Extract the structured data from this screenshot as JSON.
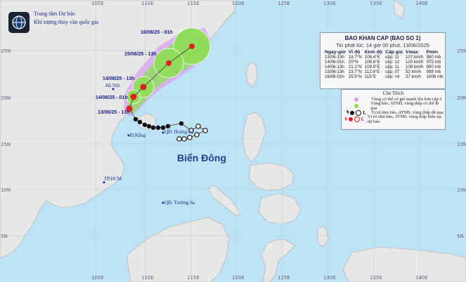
{
  "agency": {
    "line1": "Trung tâm Dự báo",
    "line2": "Khí tượng thủy văn quốc gia"
  },
  "grid": {
    "longitudes": [
      "105E",
      "110E",
      "115E",
      "120E",
      "125E",
      "130E",
      "135E",
      "140E"
    ],
    "latitudes": [
      "25N",
      "20N",
      "15N",
      "10N",
      "5N"
    ]
  },
  "places": {
    "hanoi": "Hà Nội",
    "danang": "Đ.Nẵng",
    "hcm": "TP.HCM",
    "hoangsa": "QĐ. Hoàng Sa",
    "truongsa": "QĐ. Trường Sa"
  },
  "sea_label": "Biển Đông",
  "track_times": [
    "16/06/25 - 01h",
    "15/06/25 - 13h",
    "14/06/25 - 13h",
    "14/06/25 - 01h",
    "13/06/25 - 13h"
  ],
  "bulletin": {
    "title": "BAO KHAN CAP (BAO SO 1)",
    "subtitle": "Tin phát lúc: 14 giờ 00 phút, 13/06/2025",
    "headers": [
      "Ngày-giờ",
      "Vĩ độ",
      "Kinh độ",
      "Cấp gió",
      "Vmax",
      "Pmin"
    ],
    "rows": [
      [
        "13/06-13h",
        "18.7°N",
        "108.4°E",
        "cấp: 11",
        "107 km/h",
        "980 mb"
      ],
      [
        "14/06-01h",
        "20°N",
        "108.8°E",
        "cấp: 12",
        "120 km/h",
        "975 mb"
      ],
      [
        "14/06-13h",
        "21.1°N",
        "109.9°E",
        "cấp: 11",
        "106 km/h",
        "980 mb"
      ],
      [
        "15/06-13h",
        "23.7°N",
        "112.6°E",
        "cấp: 07",
        "52 km/h",
        "998 mb"
      ],
      [
        "16/06-01h",
        "25.5°N",
        "115°E",
        "cấp: <6",
        "37 km/h",
        "1006 mb"
      ]
    ]
  },
  "legend": {
    "title": "Chú Thích",
    "items": [
      "Vùng có thể có gió mạnh lên hơn cấp 6",
      "Vùng bão, ATNĐ, vùng thấp có thể đi qua",
      "Vị trí tâm bão, ATNĐ, vùng thấp đã qua",
      "Vị trí tâm bão, ATNĐ, vùng thấp hiện tại, dự báo"
    ],
    "colors": {
      "strong_wind_zone": "#d9a0f0",
      "storm_zone": "#8fdd5a",
      "past_positions": "#111111",
      "forecast_positions": "#e02020"
    }
  },
  "colors": {
    "sea": "#bfe3f6",
    "land": "#e7e7e7",
    "track_line": "#333333"
  }
}
